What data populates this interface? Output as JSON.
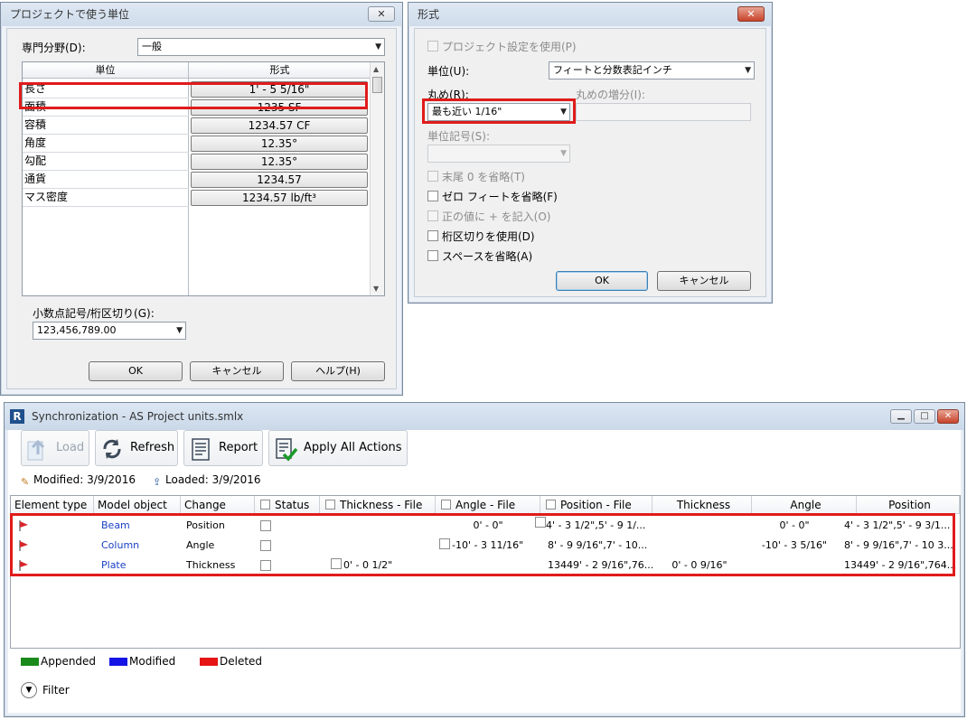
{
  "units_dialog": {
    "title": "プロジェクトで使う単位",
    "close_label": "✕",
    "discipline_label": "専門分野(D):",
    "discipline_value": "一般",
    "col_unit": "単位",
    "col_format": "形式",
    "rows": [
      {
        "unit": "長さ",
        "format": "1' - 5 5/16\""
      },
      {
        "unit": "面積",
        "format": "1235 SF"
      },
      {
        "unit": "容積",
        "format": "1234.57 CF"
      },
      {
        "unit": "角度",
        "format": "12.35°"
      },
      {
        "unit": "勾配",
        "format": "12.35°"
      },
      {
        "unit": "通貨",
        "format": "1234.57"
      },
      {
        "unit": "マス密度",
        "format": "1234.57 lb/ft³"
      }
    ],
    "decimal_label": "小数点記号/桁区切り(G):",
    "decimal_value": "123,456,789.00",
    "ok": "OK",
    "cancel": "キャンセル",
    "help": "ヘルプ(H)"
  },
  "format_dialog": {
    "title": "形式",
    "close_label": "✕",
    "use_project_settings": "プロジェクト設定を使用(P)",
    "units_label": "単位(U):",
    "units_value": "フィートと分数表記インチ",
    "rounding_label": "丸め(R):",
    "rounding_value": "最も近い 1/16\"",
    "rounding_increment_label": "丸めの増分(I):",
    "rounding_increment_value": "",
    "unit_symbol_label": "単位記号(S):",
    "unit_symbol_value": "",
    "suppress_trailing_zeros": "末尾 0 を省略(T)",
    "suppress_zero_feet": "ゼロ フィートを省略(F)",
    "show_plus": "正の値に + を記入(O)",
    "digit_grouping": "桁区切りを使用(D)",
    "suppress_spaces": "スペースを省略(A)",
    "ok": "OK",
    "cancel": "キャンセル"
  },
  "sync_window": {
    "title": "Synchronization - AS Project units.smlx",
    "app_icon": "R",
    "toolbar": {
      "load": "Load",
      "refresh": "Refresh",
      "report": "Report",
      "apply_all": "Apply All Actions"
    },
    "modified": "Modified: 3/9/2016",
    "loaded": "Loaded: 3/9/2016",
    "columns": [
      "Element type",
      "Model object",
      "Change",
      "Status",
      "Thickness - File",
      "Angle - File",
      "Position - File",
      "Thickness",
      "Angle",
      "Position"
    ],
    "rows": [
      {
        "object": "Beam",
        "change": "Position",
        "thickness_file": "",
        "angle_file": "0' - 0\"",
        "position_file": "4' - 3 1/2\",5' - 9 1/...",
        "thickness": "",
        "angle": "0' - 0\"",
        "position": "4' - 3 1/2\",5' - 9 3/1..."
      },
      {
        "object": "Column",
        "change": "Angle",
        "thickness_file": "",
        "angle_file": "-10' - 3 11/16\"",
        "position_file": "8' - 9 9/16\",7' - 10...",
        "thickness": "",
        "angle": "-10' - 3 5/16\"",
        "position": "8' - 9 9/16\",7' - 10 3..."
      },
      {
        "object": "Plate",
        "change": "Thickness",
        "thickness_file": "0' - 0 1/2\"",
        "angle_file": "",
        "position_file": "13449' - 2 9/16\",76...",
        "thickness": "0' - 0 9/16\"",
        "angle": "",
        "position": "13449' - 2 9/16\",764..."
      }
    ],
    "legend": [
      {
        "label": "Appended",
        "color": "#1a8a1a"
      },
      {
        "label": "Modified",
        "color": "#1414e6"
      },
      {
        "label": "Deleted",
        "color": "#e61414"
      }
    ],
    "filter": "Filter"
  }
}
